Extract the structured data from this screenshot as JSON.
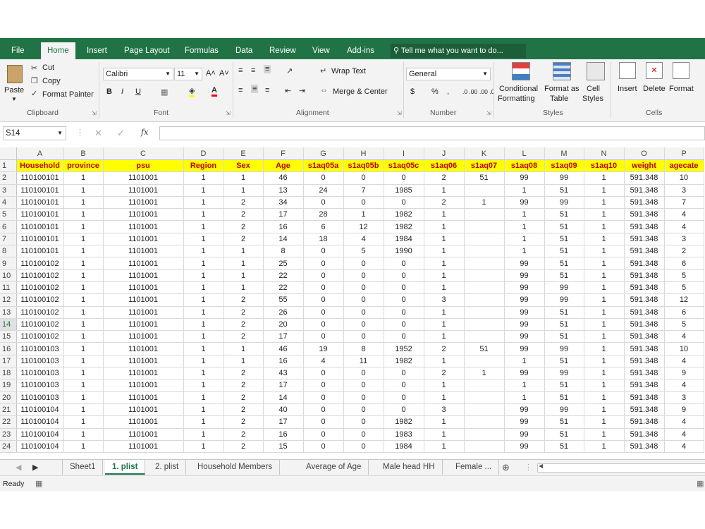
{
  "ribbon_tabs": [
    "File",
    "Home",
    "Insert",
    "Page Layout",
    "Formulas",
    "Data",
    "Review",
    "View",
    "Add-ins"
  ],
  "tell_me": "Tell me what you want to do...",
  "clipboard": {
    "paste": "Paste",
    "cut": "Cut",
    "copy": "Copy",
    "format_painter": "Format Painter",
    "label": "Clipboard"
  },
  "font": {
    "name": "Calibri",
    "size": "11",
    "label": "Font",
    "bold": "B",
    "italic": "I",
    "underline": "U",
    "grow": "A˄",
    "shrink": "A˅"
  },
  "alignment": {
    "wrap": "Wrap Text",
    "merge": "Merge & Center",
    "label": "Alignment"
  },
  "number": {
    "format": "General",
    "currency": "$",
    "percent": "%",
    "comma": ",",
    "inc_dec": ".0 .00",
    "dec_dec": ".00 .0",
    "label": "Number"
  },
  "styles": {
    "conditional": "Conditional",
    "conditional2": "Formatting",
    "format_table": "Format as",
    "format_table2": "Table",
    "cell_styles": "Cell",
    "cell_styles2": "Styles",
    "label": "Styles"
  },
  "cells": {
    "insert": "Insert",
    "delete": "Delete",
    "format": "Format",
    "label": "Cells"
  },
  "name_box": "S14",
  "fx": "fx",
  "columns": [
    "A",
    "B",
    "C",
    "D",
    "E",
    "F",
    "G",
    "H",
    "I",
    "J",
    "K",
    "L",
    "M",
    "N",
    "O",
    "P"
  ],
  "header_row": [
    "Household",
    "province",
    "psu",
    "Region",
    "Sex",
    "Age",
    "s1aq05a",
    "s1aq05b",
    "s1aq05c",
    "s1aq06",
    "s1aq07",
    "s1aq08",
    "s1aq09",
    "s1aq10",
    "weight",
    "agecate"
  ],
  "rows": [
    [
      "110100101",
      "1",
      "1101001",
      "1",
      "1",
      "46",
      "0",
      "0",
      "0",
      "2",
      "51",
      "99",
      "99",
      "1",
      "591.348",
      "10"
    ],
    [
      "110100101",
      "1",
      "1101001",
      "1",
      "1",
      "13",
      "24",
      "7",
      "1985",
      "1",
      "",
      "1",
      "51",
      "1",
      "591.348",
      "3"
    ],
    [
      "110100101",
      "1",
      "1101001",
      "1",
      "2",
      "34",
      "0",
      "0",
      "0",
      "2",
      "1",
      "99",
      "99",
      "1",
      "591.348",
      "7"
    ],
    [
      "110100101",
      "1",
      "1101001",
      "1",
      "2",
      "17",
      "28",
      "1",
      "1982",
      "1",
      "",
      "1",
      "51",
      "1",
      "591.348",
      "4"
    ],
    [
      "110100101",
      "1",
      "1101001",
      "1",
      "2",
      "16",
      "6",
      "12",
      "1982",
      "1",
      "",
      "1",
      "51",
      "1",
      "591.348",
      "4"
    ],
    [
      "110100101",
      "1",
      "1101001",
      "1",
      "2",
      "14",
      "18",
      "4",
      "1984",
      "1",
      "",
      "1",
      "51",
      "1",
      "591.348",
      "3"
    ],
    [
      "110100101",
      "1",
      "1101001",
      "1",
      "1",
      "8",
      "0",
      "5",
      "1990",
      "1",
      "",
      "1",
      "51",
      "1",
      "591.348",
      "2"
    ],
    [
      "110100102",
      "1",
      "1101001",
      "1",
      "1",
      "25",
      "0",
      "0",
      "0",
      "1",
      "",
      "99",
      "51",
      "1",
      "591.348",
      "6"
    ],
    [
      "110100102",
      "1",
      "1101001",
      "1",
      "1",
      "22",
      "0",
      "0",
      "0",
      "1",
      "",
      "99",
      "51",
      "1",
      "591.348",
      "5"
    ],
    [
      "110100102",
      "1",
      "1101001",
      "1",
      "1",
      "22",
      "0",
      "0",
      "0",
      "1",
      "",
      "99",
      "99",
      "1",
      "591.348",
      "5"
    ],
    [
      "110100102",
      "1",
      "1101001",
      "1",
      "2",
      "55",
      "0",
      "0",
      "0",
      "3",
      "",
      "99",
      "99",
      "1",
      "591.348",
      "12"
    ],
    [
      "110100102",
      "1",
      "1101001",
      "1",
      "2",
      "26",
      "0",
      "0",
      "0",
      "1",
      "",
      "99",
      "51",
      "1",
      "591.348",
      "6"
    ],
    [
      "110100102",
      "1",
      "1101001",
      "1",
      "2",
      "20",
      "0",
      "0",
      "0",
      "1",
      "",
      "99",
      "51",
      "1",
      "591.348",
      "5"
    ],
    [
      "110100102",
      "1",
      "1101001",
      "1",
      "2",
      "17",
      "0",
      "0",
      "0",
      "1",
      "",
      "99",
      "51",
      "1",
      "591.348",
      "4"
    ],
    [
      "110100103",
      "1",
      "1101001",
      "1",
      "1",
      "46",
      "19",
      "8",
      "1952",
      "2",
      "51",
      "99",
      "99",
      "1",
      "591.348",
      "10"
    ],
    [
      "110100103",
      "1",
      "1101001",
      "1",
      "1",
      "16",
      "4",
      "11",
      "1982",
      "1",
      "",
      "1",
      "51",
      "1",
      "591.348",
      "4"
    ],
    [
      "110100103",
      "1",
      "1101001",
      "1",
      "2",
      "43",
      "0",
      "0",
      "0",
      "2",
      "1",
      "99",
      "99",
      "1",
      "591.348",
      "9"
    ],
    [
      "110100103",
      "1",
      "1101001",
      "1",
      "2",
      "17",
      "0",
      "0",
      "0",
      "1",
      "",
      "1",
      "51",
      "1",
      "591.348",
      "4"
    ],
    [
      "110100103",
      "1",
      "1101001",
      "1",
      "2",
      "14",
      "0",
      "0",
      "0",
      "1",
      "",
      "1",
      "51",
      "1",
      "591.348",
      "3"
    ],
    [
      "110100104",
      "1",
      "1101001",
      "1",
      "2",
      "40",
      "0",
      "0",
      "0",
      "3",
      "",
      "99",
      "99",
      "1",
      "591.348",
      "9"
    ],
    [
      "110100104",
      "1",
      "1101001",
      "1",
      "2",
      "17",
      "0",
      "0",
      "1982",
      "1",
      "",
      "99",
      "51",
      "1",
      "591.348",
      "4"
    ],
    [
      "110100104",
      "1",
      "1101001",
      "1",
      "2",
      "16",
      "0",
      "0",
      "1983",
      "1",
      "",
      "99",
      "51",
      "1",
      "591.348",
      "4"
    ],
    [
      "110100104",
      "1",
      "1101001",
      "1",
      "2",
      "15",
      "0",
      "0",
      "1984",
      "1",
      "",
      "99",
      "51",
      "1",
      "591.348",
      "4"
    ]
  ],
  "sheet_tabs": [
    "Sheet1",
    "1. plist",
    "2. plist",
    "Household Members",
    "Average of Age",
    "Male head HH",
    "Female ..."
  ],
  "status": "Ready",
  "colors": {
    "excel_green": "#217346",
    "header_fill": "#ffff00",
    "header_text": "#c00000"
  }
}
